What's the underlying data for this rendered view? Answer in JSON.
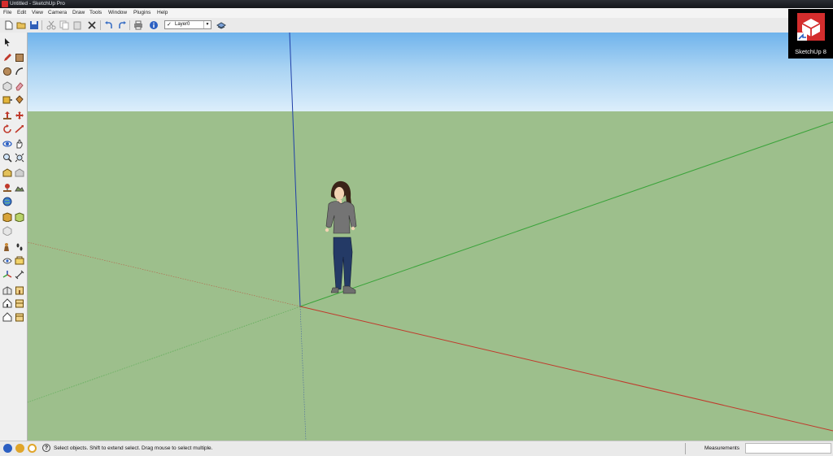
{
  "window": {
    "title": "Untitled - SketchUp Pro"
  },
  "menu": [
    "File",
    "Edit",
    "View",
    "Camera",
    "Draw",
    "Tools",
    "Window",
    "Plugins",
    "Help"
  ],
  "toolbar": {
    "layer": {
      "value": "Layer0",
      "checked": "✓"
    }
  },
  "badge": {
    "label": "SketchUp 8"
  },
  "status": {
    "hint": "Select objects. Shift to extend select. Drag mouse to select multiple.",
    "help_glyph": "?",
    "measurements_label": "Measurements",
    "measurements_value": ""
  },
  "colors": {
    "sky": "#8ec5f0",
    "ground": "#9dbf8c",
    "axis_red": "#c0392b",
    "axis_green": "#3aa33a",
    "axis_blue": "#1f3fa8",
    "brand_red": "#d42d2d"
  }
}
